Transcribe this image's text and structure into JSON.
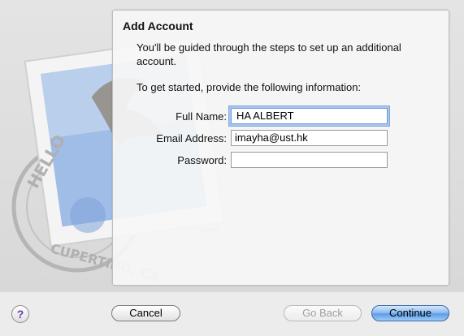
{
  "dialog": {
    "title": "Add Account",
    "intro": "You'll be guided through the steps to set up an additional account.",
    "prompt": "To get started, provide the following information:",
    "fields": {
      "full_name": {
        "label": "Full Name:",
        "value": "HA ALBERT"
      },
      "email": {
        "label": "Email Address:",
        "value": "imayha@ust.hk"
      },
      "password": {
        "label": "Password:",
        "value": ""
      }
    }
  },
  "buttons": {
    "help": "?",
    "cancel": "Cancel",
    "go_back": "Go Back",
    "continue": "Continue"
  },
  "colors": {
    "focus_ring": "#a9c7ef",
    "default_button": "#5d9de8",
    "help_glyph": "#6a3fb0"
  }
}
